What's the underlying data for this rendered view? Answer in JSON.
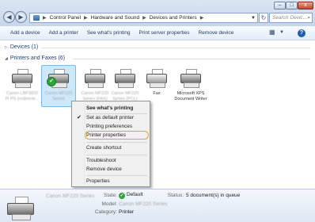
{
  "window": {
    "buttons": {
      "minimize": "–",
      "maximize": "□",
      "close": "x"
    }
  },
  "nav": {
    "back": "◀",
    "forward": "▶",
    "breadcrumbs": [
      "Control Panel",
      "Hardware and Sound",
      "Devices and Printers"
    ],
    "refresh": "↻",
    "search_placeholder": "Search Devic..."
  },
  "toolbar": {
    "items": [
      "Add a device",
      "Add a printer",
      "See what's printing",
      "Print server properties",
      "Remove device"
    ]
  },
  "groups": {
    "devices": "Devices (1)",
    "printers": "Printers and Faxes (6)"
  },
  "printers": [
    {
      "label": "Canon LBP3820 Pl PS (redirecte...",
      "blurred": true,
      "default": false,
      "selected": false
    },
    {
      "label": "Canon MF220 Series",
      "blurred": true,
      "default": true,
      "selected": true
    },
    {
      "label": "Canon MF220 Series (FAX)",
      "blurred": true,
      "default": false,
      "selected": false
    },
    {
      "label": "Canon MF220 Series (PCL)",
      "blurred": true,
      "default": false,
      "selected": false
    },
    {
      "label": "Fax",
      "blurred": false,
      "default": false,
      "selected": false
    },
    {
      "label": "Microsoft XPS Document Writer",
      "blurred": false,
      "default": false,
      "selected": false
    }
  ],
  "context_menu": {
    "items": [
      {
        "label": "See what's printing",
        "bold": true
      },
      {
        "label": "Set as default printer",
        "checked": true
      },
      {
        "label": "Printing preferences"
      },
      {
        "label": "Printer properties",
        "highlighted": true
      },
      {
        "label": "Create shortcut"
      },
      {
        "label": "Troubleshoot"
      },
      {
        "label": "Remove device"
      },
      {
        "label": "Properties"
      }
    ]
  },
  "details": {
    "name": "Canon MF220 Series",
    "state_key": "State:",
    "state_value": "Default",
    "status_key": "Status:",
    "status_value": "5 document(s) in queue",
    "model_key": "Model:",
    "model_value": "Canon MF220 Series",
    "category_key": "Category:",
    "category_value": "Printer"
  },
  "colors": {
    "accent": "#1e3e78",
    "highlight_ring": "#f2a11a",
    "default_check": "#2ea43a",
    "selection": "#cde8fb"
  }
}
